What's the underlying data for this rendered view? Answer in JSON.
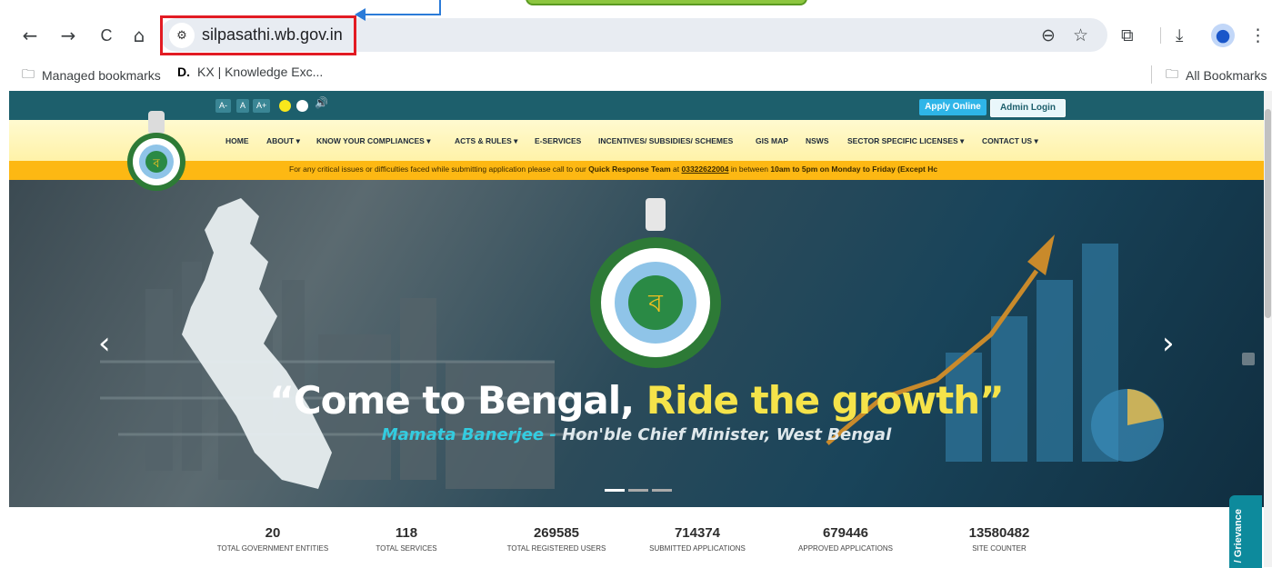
{
  "browser": {
    "url": "silpasathi.wb.gov.in",
    "nav": {
      "back": "←",
      "forward": "→",
      "reload": "C",
      "home": "⌂"
    },
    "icons": {
      "zoom": "⊖",
      "star": "☆",
      "extensions": "⧉",
      "download": "⤓",
      "profile": "●",
      "menu": "⋮"
    },
    "bookmarks": {
      "managed": "Managed bookmarks",
      "kx_prefix": "D.",
      "kx": "KX | Knowledge Exc...",
      "all": "All Bookmarks"
    }
  },
  "site": {
    "accessibility": {
      "font_small": "A-",
      "font_normal": "A",
      "font_large": "A+",
      "speaker": "🔊"
    },
    "apply_online": "Apply Online",
    "admin_login": "Admin Login",
    "menu": [
      "HOME",
      "ABOUT ▾",
      "KNOW YOUR COMPLIANCES ▾",
      "ACTS & RULES ▾",
      "E-SERVICES",
      "INCENTIVES/ SUBSIDIES/ SCHEMES",
      "GIS MAP",
      "NSWS",
      "SECTOR SPECIFIC LICENSES ▾",
      "CONTACT US ▾"
    ],
    "notice": {
      "pre": "For any critical issues or difficulties faced while submitting application please call to our ",
      "team": "Quick Response Team",
      "at": " at ",
      "phone": "03322622004",
      "mid": " in between ",
      "hours": "10am to 5pm on Monday to Friday (Except Hc"
    },
    "hero": {
      "quote_part1": "“Come to Bengal, ",
      "quote_part2": "Ride the growth”",
      "attribution_name": "Mamata Banerjee -",
      "attribution_rest": " Hon'ble Chief Minister, West Bengal",
      "prev": "‹",
      "next": "›"
    },
    "stats": [
      {
        "value": "20",
        "label": "TOTAL GOVERNMENT ENTITIES"
      },
      {
        "value": "118",
        "label": "TOTAL SERVICES"
      },
      {
        "value": "269585",
        "label": "TOTAL REGISTERED USERS"
      },
      {
        "value": "714374",
        "label": "SUBMITTED APPLICATIONS"
      },
      {
        "value": "679446",
        "label": "APPROVED APPLICATIONS"
      },
      {
        "value": "13580482",
        "label": "SITE COUNTER"
      }
    ],
    "grievance": "/ Grievance"
  }
}
